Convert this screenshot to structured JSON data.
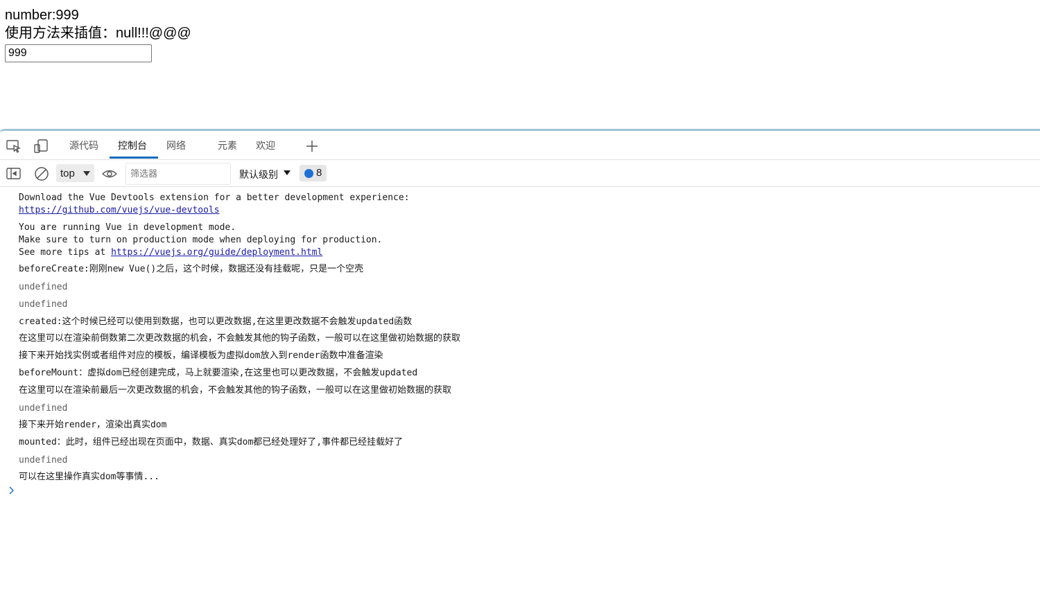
{
  "page": {
    "line1": "number:999",
    "line2": "使用方法来插值：null!!!@@@",
    "input_value": "999"
  },
  "devtools": {
    "tabs": [
      {
        "label": "源代码"
      },
      {
        "label": "控制台"
      },
      {
        "label": "网络"
      },
      {
        "label": "元素"
      },
      {
        "label": "欢迎"
      }
    ],
    "toolbar": {
      "context": "top",
      "filter_placeholder": "筛选器",
      "level": "默认级别",
      "message_count": "8"
    },
    "console": {
      "m1_line1": "Download the Vue Devtools extension for a better development experience:",
      "m1_link": "https://github.com/vuejs/vue-devtools",
      "m2_line1": "You are running Vue in development mode.",
      "m2_line2": "Make sure to turn on production mode when deploying for production.",
      "m2_line3_prefix": "See more tips at ",
      "m2_link": "https://vuejs.org/guide/deployment.html",
      "m3": "beforeCreate:刚刚new Vue()之后，这个时候，数据还没有挂载呢，只是一个空壳",
      "m4": "undefined",
      "m5": "undefined",
      "m6": "created:这个时候已经可以使用到数据，也可以更改数据,在这里更改数据不会触发updated函数",
      "m7": "在这里可以在渲染前倒数第二次更改数据的机会，不会触发其他的钩子函数，一般可以在这里做初始数据的获取",
      "m8": "接下来开始找实例或者组件对应的模板，编译模板为虚拟dom放入到render函数中准备渲染",
      "m9": "beforeMount：虚拟dom已经创建完成，马上就要渲染,在这里也可以更改数据，不会触发updated",
      "m10": "在这里可以在渲染前最后一次更改数据的机会，不会触发其他的钩子函数，一般可以在这里做初始数据的获取",
      "m11": "undefined",
      "m12": "接下来开始render，渲染出真实dom",
      "m13": "mounted：此时，组件已经出现在页面中，数据、真实dom都已经处理好了,事件都已经挂载好了",
      "m14": "undefined",
      "m15": "可以在这里操作真实dom等事情..."
    }
  },
  "colors": {
    "accent": "#0f6cbd",
    "link": "#1a1aa6",
    "badge": "#1f6fd6",
    "divider": "#9fc3d4"
  }
}
